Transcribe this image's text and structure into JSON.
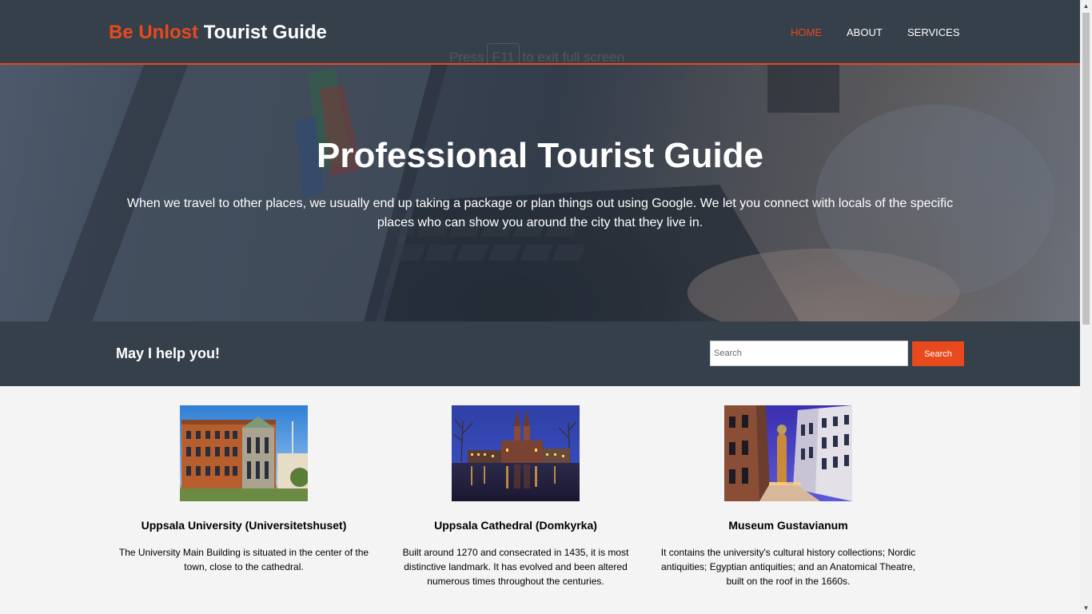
{
  "header": {
    "logo_highlight": "Be Unlost",
    "logo_rest": "Tourist Guide",
    "nav": [
      "HOME",
      "ABOUT",
      "SERVICES"
    ],
    "active_nav": "HOME",
    "fullscreen_hint": {
      "before": "Press",
      "key": "F11",
      "after": "to exit full screen"
    }
  },
  "hero": {
    "title": "Professional Tourist Guide",
    "text": "When we travel to other places, we usually end up taking a package or plan things out using Google. We let you connect with locals of the specific places who can show you around the city that they live in."
  },
  "help": {
    "title": "May I help you!",
    "search_placeholder": "Search",
    "search_button": "Search"
  },
  "boxes": [
    {
      "title": "Uppsala University (Universitetshuset)",
      "text": "The University Main Building is situated in the center of the town, close to the cathedral.",
      "image": "university-building-photo"
    },
    {
      "title": "Uppsala Cathedral (Domkyrka)",
      "text": "Built around 1270 and consecrated in 1435, it is most distinctive landmark. It has evolved and been altered numerous times throughout the centuries.",
      "image": "cathedral-night-photo"
    },
    {
      "title": "Museum Gustavianum",
      "text": "It contains the university's cultural history collections; Nordic antiquities; Egyptian antiquities; and an Anatomical Theatre, built on the roof in the 1660s.",
      "image": "museum-street-photo"
    }
  ],
  "colors": {
    "accent": "#e8491d",
    "dark": "#35404b",
    "background": "#f4f4f4"
  }
}
